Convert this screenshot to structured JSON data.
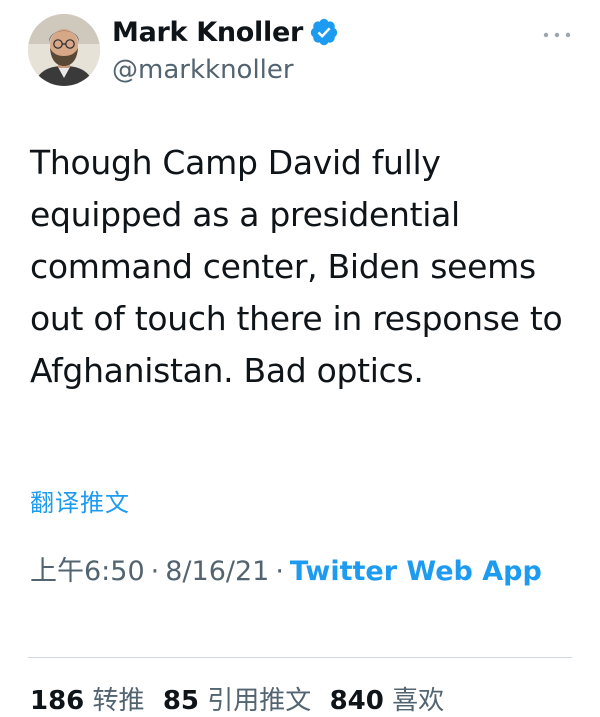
{
  "author": {
    "display_name": "Mark Knoller",
    "handle": "@markknoller",
    "verified": true,
    "avatar_icon": "user-avatar"
  },
  "tweet": {
    "text": "Though Camp David fully equipped as a presidential command center, Biden seems out of touch there in response to Afghanistan. Bad optics.",
    "translate_label": "翻译推文"
  },
  "meta": {
    "time": "上午6:50",
    "date": "8/16/21",
    "separator": "·",
    "source": "Twitter Web App"
  },
  "stats": {
    "retweets_count": "186",
    "retweets_label": "转推",
    "quotes_count": "85",
    "quotes_label": "引用推文",
    "likes_count": "840",
    "likes_label": "喜欢"
  },
  "colors": {
    "link_blue": "#1d9bf0",
    "text_primary": "#0f1419",
    "text_secondary": "#536471",
    "divider": "#cfd9de"
  }
}
